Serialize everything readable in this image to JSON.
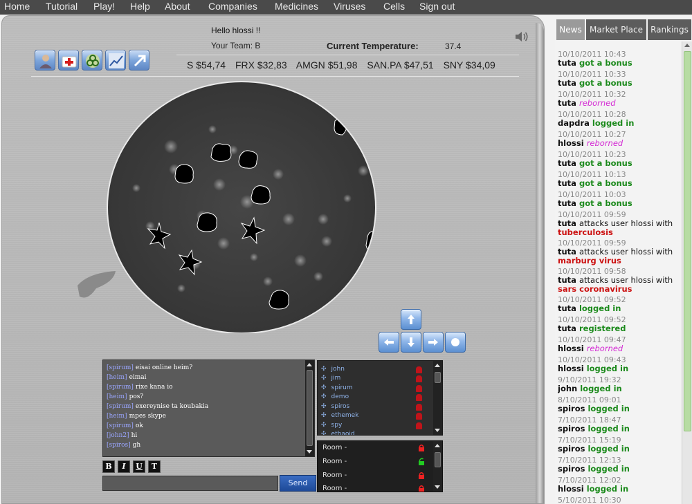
{
  "nav": {
    "items": [
      "Home",
      "Tutorial",
      "Play!",
      "Help",
      "About",
      "Companies",
      "Medicines",
      "Viruses",
      "Cells",
      "Sign out"
    ]
  },
  "header": {
    "greeting": "Hello hlossi !!",
    "team": "Your Team: B",
    "temperature_label": "Current Temperature:",
    "temperature_value": "37.4"
  },
  "toolbar": {
    "icons": [
      "user-icon",
      "first-aid-icon",
      "biohazard-icon",
      "chart-icon",
      "arrow-icon"
    ]
  },
  "stocks": [
    {
      "symbol": "S",
      "price": "$54,74"
    },
    {
      "symbol": "FRX",
      "price": "$32,83"
    },
    {
      "symbol": "AMGN",
      "price": "$51,98"
    },
    {
      "symbol": "SAN.PA",
      "price": "$47,51"
    },
    {
      "symbol": "SNY",
      "price": "$34,09"
    }
  ],
  "chat": {
    "messages": [
      {
        "nick": "[spirum]",
        "text": "eisai online heim?"
      },
      {
        "nick": "[heim]",
        "text": "eimai"
      },
      {
        "nick": "[spirum]",
        "text": "rixe kana io"
      },
      {
        "nick": "[heim]",
        "text": "pos?"
      },
      {
        "nick": "[spirum]",
        "text": "exereynise ta koubakia"
      },
      {
        "nick": "[heim]",
        "text": "mpes skype"
      },
      {
        "nick": "[spirum]",
        "text": "ok"
      },
      {
        "nick": "[john2]",
        "text": "hi"
      },
      {
        "nick": "[spiros]",
        "text": "gh"
      }
    ],
    "format_buttons": [
      "B",
      "I",
      "U",
      "T"
    ],
    "send_label": "Send"
  },
  "users": [
    "john",
    "jim",
    "spirum",
    "demo",
    "spiros",
    "ethemek",
    "spy",
    "ethaoid"
  ],
  "rooms": [
    {
      "label": "Room -",
      "locked": true
    },
    {
      "label": "Room -",
      "locked": false
    },
    {
      "label": "Room -",
      "locked": true
    },
    {
      "label": "Room -",
      "locked": true
    }
  ],
  "tabs": [
    "News",
    "Market Place",
    "Rankings"
  ],
  "news": [
    {
      "time": "10/10/2011 10:43",
      "user": "tuta",
      "action": "got a bonus",
      "kind": "g"
    },
    {
      "time": "10/10/2011 10:33",
      "user": "tuta",
      "action": "got a bonus",
      "kind": "g"
    },
    {
      "time": "10/10/2011 10:32",
      "user": "tuta",
      "action": "reborned",
      "kind": "m"
    },
    {
      "time": "10/10/2011 10:28",
      "user": "dapdra",
      "action": "logged in",
      "kind": "g"
    },
    {
      "time": "10/10/2011 10:27",
      "user": "hlossi",
      "action": "reborned",
      "kind": "m"
    },
    {
      "time": "10/10/2011 10:23",
      "user": "tuta",
      "action": "got a bonus",
      "kind": "g"
    },
    {
      "time": "10/10/2011 10:13",
      "user": "tuta",
      "action": "got a bonus",
      "kind": "g"
    },
    {
      "time": "10/10/2011 10:03",
      "user": "tuta",
      "action": "got a bonus",
      "kind": "g"
    },
    {
      "time": "10/10/2011 09:59",
      "user": "tuta",
      "action": "attacks user hlossi with",
      "kind": "attack",
      "virus": "tuberculosis"
    },
    {
      "time": "10/10/2011 09:59",
      "user": "tuta",
      "action": "attacks user hlossi with",
      "kind": "attack",
      "virus": "marburg virus"
    },
    {
      "time": "10/10/2011 09:58",
      "user": "tuta",
      "action": "attacks user hlossi with",
      "kind": "attack",
      "virus": "sars coronavirus"
    },
    {
      "time": "10/10/2011 09:52",
      "user": "tuta",
      "action": "logged in",
      "kind": "g"
    },
    {
      "time": "10/10/2011 09:52",
      "user": "tuta",
      "action": "registered",
      "kind": "g"
    },
    {
      "time": "10/10/2011 09:47",
      "user": "hlossi",
      "action": "reborned",
      "kind": "m"
    },
    {
      "time": "10/10/2011 09:43",
      "user": "hlossi",
      "action": "logged in",
      "kind": "g"
    },
    {
      "time": "9/10/2011 19:32",
      "user": "john",
      "action": "logged in",
      "kind": "g"
    },
    {
      "time": "8/10/2011 09:01",
      "user": "spiros",
      "action": "logged in",
      "kind": "g"
    },
    {
      "time": "7/10/2011 18:47",
      "user": "spiros",
      "action": "logged in",
      "kind": "g"
    },
    {
      "time": "7/10/2011 15:19",
      "user": "spiros",
      "action": "logged in",
      "kind": "g"
    },
    {
      "time": "7/10/2011 12:13",
      "user": "spiros",
      "action": "logged in",
      "kind": "g"
    },
    {
      "time": "7/10/2011 12:02",
      "user": "hlossi",
      "action": "logged in",
      "kind": "g"
    },
    {
      "time": "5/10/2011 10:30",
      "user": "",
      "action": "",
      "kind": "g"
    }
  ],
  "colors": {
    "nav_bg": "#4a4a4a",
    "green": "#1c8a1c",
    "magenta": "#d42ad4",
    "red": "#cc1212",
    "tab_active": "#9a9a9a"
  }
}
